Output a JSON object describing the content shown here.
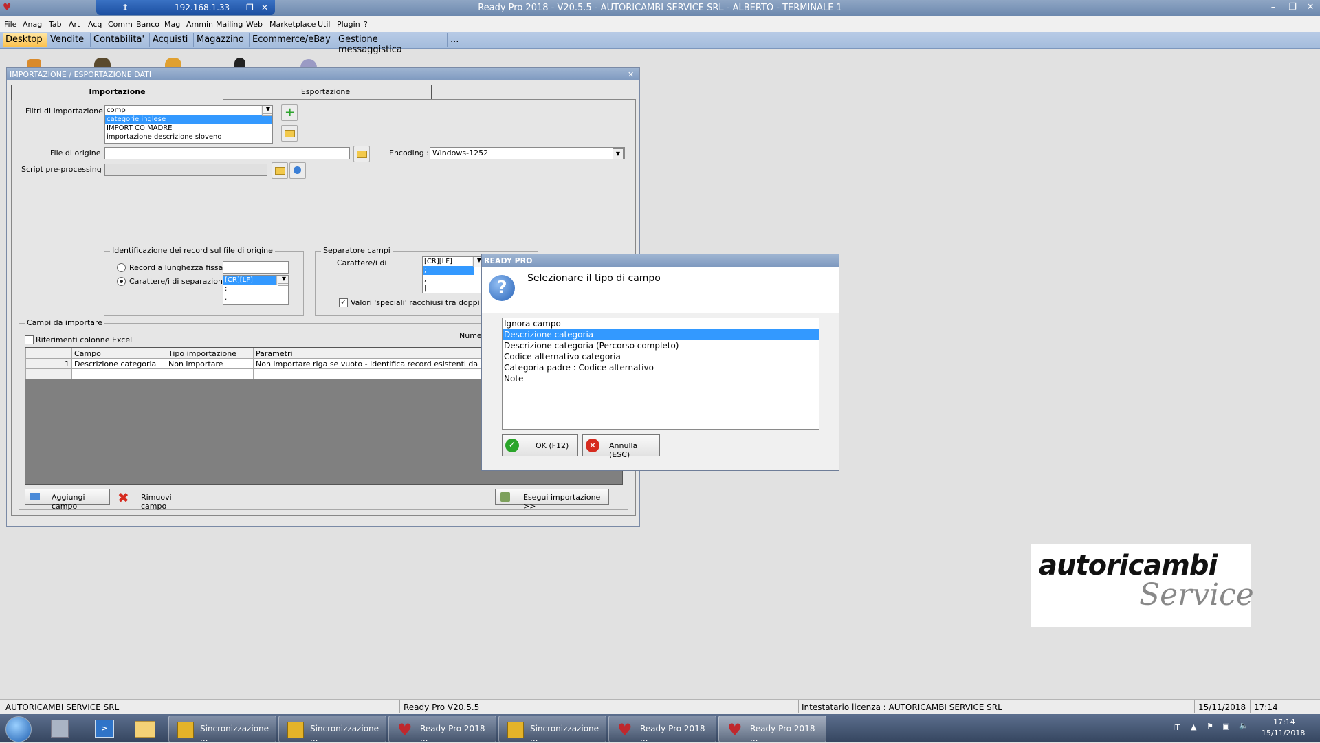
{
  "window": {
    "title": "Ready Pro 2018 - V20.5.5 - AUTORICAMBI SERVICE SRL - ALBERTO - TERMINALE 1",
    "remote_ip": "192.168.1.33"
  },
  "menu": [
    "File",
    "Anag",
    "Tab",
    "Art",
    "Acq",
    "Comm",
    "Banco",
    "Mag",
    "Ammin",
    "Mailing",
    "Web",
    "Marketplace",
    "Util",
    "Plugin",
    "?"
  ],
  "app_tabs": [
    "Desktop",
    "Vendite",
    "Contabilita'",
    "Acquisti",
    "Magazzino",
    "Ecommerce/eBay",
    "Gestione messaggistica",
    "..."
  ],
  "import_window": {
    "title": "IMPORTAZIONE / ESPORTAZIONE DATI",
    "tabs": [
      "Importazione",
      "Esportazione"
    ],
    "filters_label": "Filtri di importazione :",
    "filters": [
      "comp",
      "categorie inglese",
      "IMPORT CO MADRE",
      "importazione descrizione sloveno"
    ],
    "file_label": "File di origine :",
    "file_value": "",
    "encoding_label": "Encoding :",
    "encoding_value": "Windows-1252",
    "script_label": "Script pre-processing :",
    "ident_group": "Identificazione dei record sul file di origine",
    "radio_fixed": "Record a lunghezza fissa",
    "radio_sep": "Carattere/i di separazione",
    "sep_list": [
      "[CR][LF]",
      ";",
      ","
    ],
    "sep_group": "Separatore campi",
    "sep_chars_label": "Carattere/i di",
    "sep2_list": [
      "[CR][LF]",
      ";",
      ",",
      "|"
    ],
    "special_values": "Valori 'speciali' racchiusi tra doppi apici",
    "fields_group": "Campi da importare",
    "excel_refs": "Riferimenti colonne Excel",
    "numero_label": "Numero c",
    "grid_headers": [
      "Campo",
      "Tipo importazione",
      "Parametri"
    ],
    "grid_rows": [
      {
        "num": "1",
        "campo": "Descrizione categoria",
        "tipo": "Non importare",
        "param": "Non importare riga se vuoto - Identifica record esistenti da aggiorn"
      }
    ],
    "btn_add": "Aggiungi campo",
    "btn_remove": "Rimuovi campo",
    "btn_run": "Esegui importazione >>"
  },
  "dialog": {
    "title": "READY PRO",
    "question": "Selezionare il tipo di campo",
    "options": [
      "Ignora campo",
      "Descrizione categoria",
      "Descrizione categoria (Percorso completo)",
      "Codice alternativo categoria",
      "Categoria padre : Codice alternativo",
      "Note"
    ],
    "selected_index": 1,
    "ok": "OK (F12)",
    "cancel": "Annulla (ESC)"
  },
  "logo": {
    "line1": "autoricambi",
    "line2": "Service"
  },
  "status": {
    "company": "AUTORICAMBI SERVICE SRL",
    "version": "Ready Pro V20.5.5",
    "license": "Intestatario licenza : AUTORICAMBI SERVICE SRL",
    "date": "15/11/2018",
    "time": "17:14"
  },
  "taskbar": {
    "tasks": [
      "Sincronizzazione ...",
      "Sincronizzazione ...",
      "Ready Pro 2018 - ...",
      "Sincronizzazione ...",
      "Ready Pro 2018 - ...",
      "Ready Pro 2018 - ..."
    ],
    "lang": "IT",
    "clock_time": "17:14",
    "clock_date": "15/11/2018"
  },
  "colors": {
    "selection": "#3399ff",
    "active_tab": "#fbc14e",
    "titlebar": "#7e99bf"
  }
}
